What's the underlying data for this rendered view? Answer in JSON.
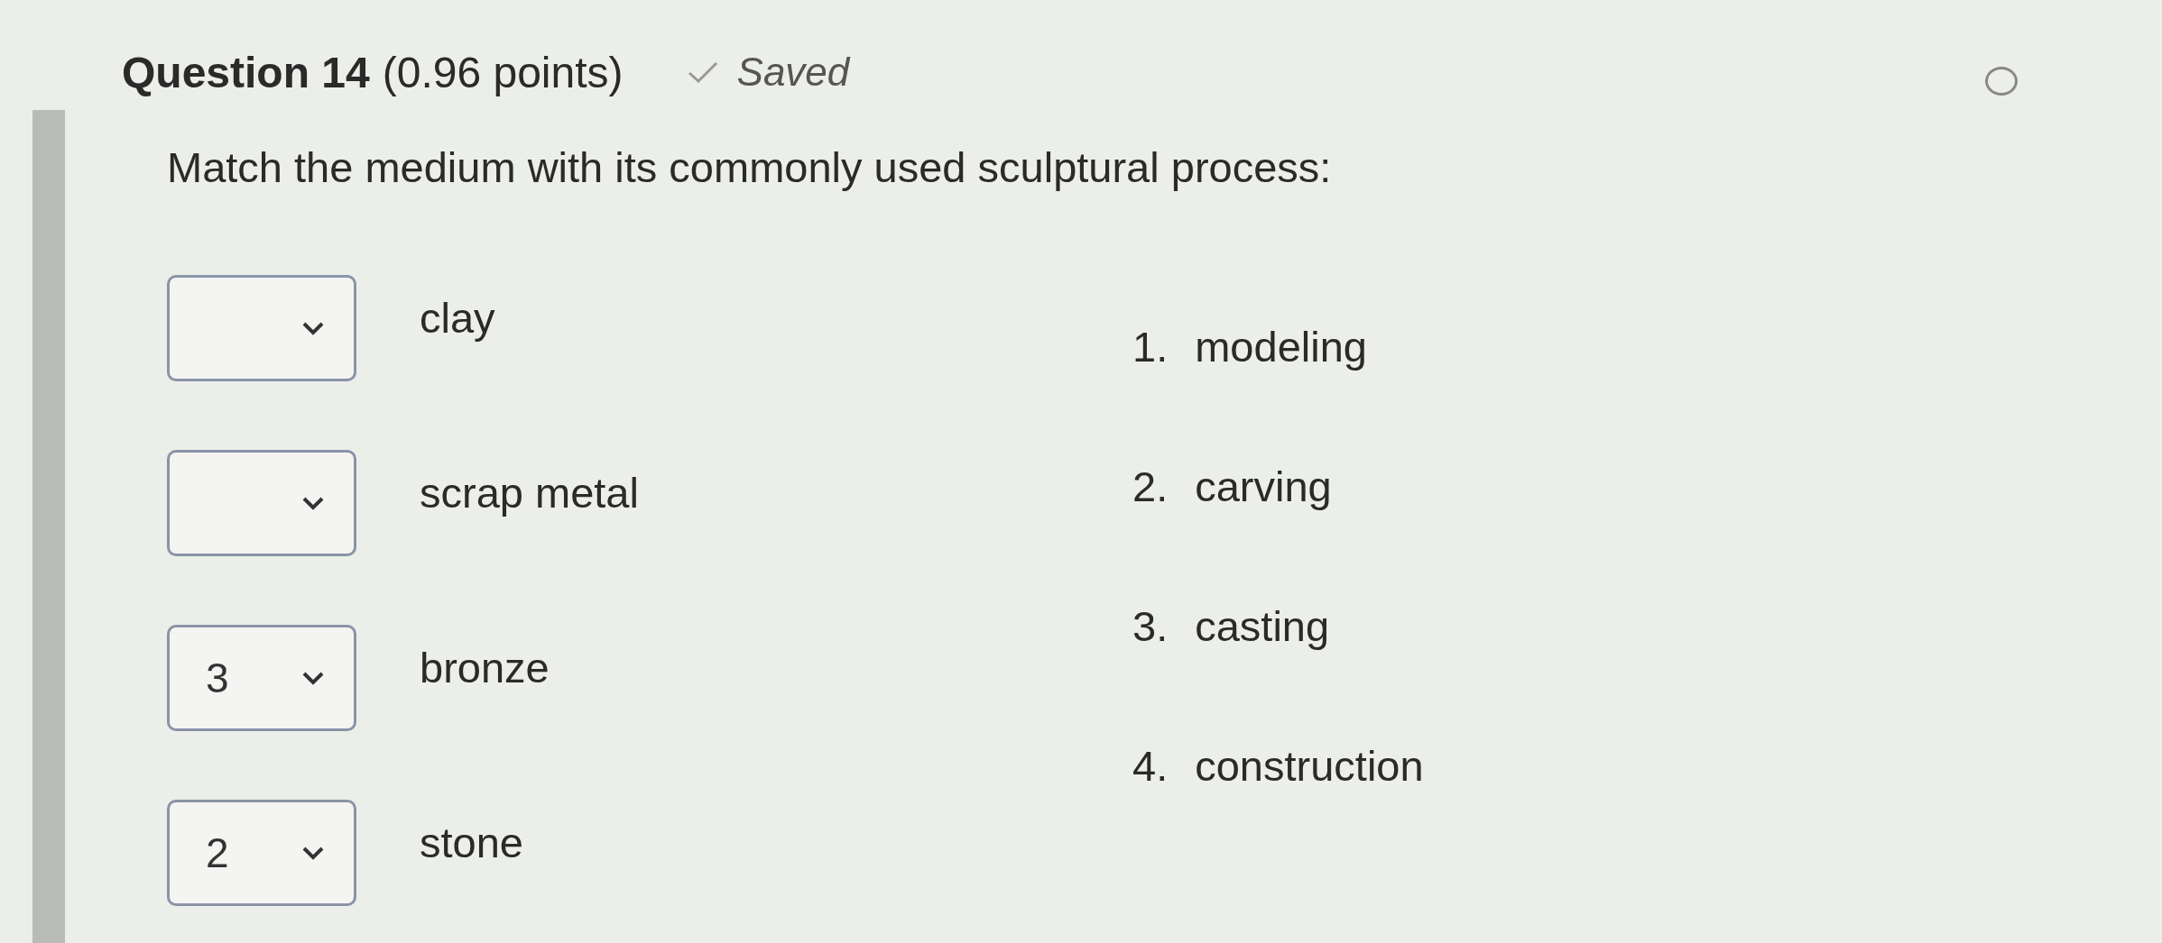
{
  "header": {
    "title": "Question 14",
    "points": "(0.96 points)",
    "status": "Saved"
  },
  "prompt": "Match the medium with its commonly used sculptural process:",
  "matches": [
    {
      "medium": "clay"
    },
    {
      "medium": "scrap metal"
    },
    {
      "value": "3",
      "medium": "bronze"
    },
    {
      "value": "2",
      "medium": "stone"
    }
  ],
  "choices": [
    {
      "number": "1.",
      "text": "modeling"
    },
    {
      "number": "2.",
      "text": "carving"
    },
    {
      "number": "3.",
      "text": "casting"
    },
    {
      "number": "4.",
      "text": "construction"
    }
  ]
}
